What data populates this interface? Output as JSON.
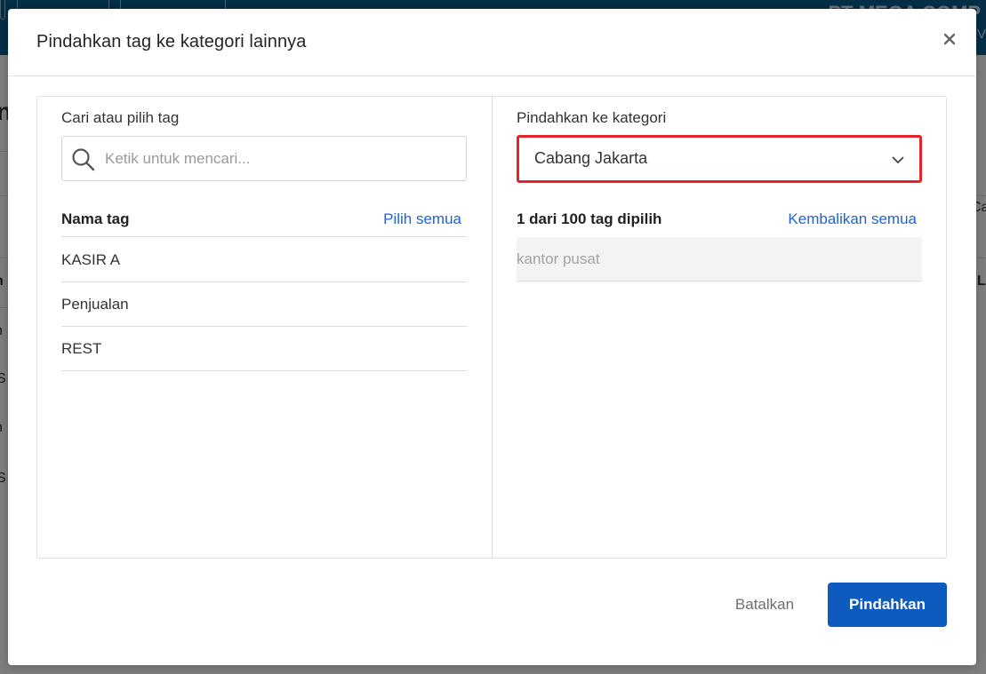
{
  "background": {
    "company_name": "PT MEGA COMP",
    "company_sub": "V",
    "row_fragments": [
      "n",
      "n",
      "n",
      "S",
      "n",
      "S"
    ],
    "right_fragments": [
      "Ca",
      "L"
    ]
  },
  "modal": {
    "title": "Pindahkan tag ke kategori lainnya",
    "close_icon": "close-icon",
    "left": {
      "label": "Cari atau pilih tag",
      "search_placeholder": "Ketik untuk mencari...",
      "column_header": "Nama tag",
      "select_all": "Pilih semua",
      "tags": [
        {
          "label": "KASIR A"
        },
        {
          "label": "Penjualan"
        },
        {
          "label": "REST"
        }
      ]
    },
    "right": {
      "label": "Pindahkan ke kategori",
      "category_value": "Cabang Jakarta",
      "selected_count": "1 dari 100 tag dipilih",
      "restore_all": "Kembalikan semua",
      "selected_tags": [
        {
          "label": "kantor pusat"
        }
      ]
    },
    "footer": {
      "cancel": "Batalkan",
      "submit": "Pindahkan"
    }
  },
  "colors": {
    "primary": "#0e5bbf",
    "link": "#1e63d4",
    "highlight_border": "#e3242b",
    "header_bg": "#0b5d8f"
  }
}
